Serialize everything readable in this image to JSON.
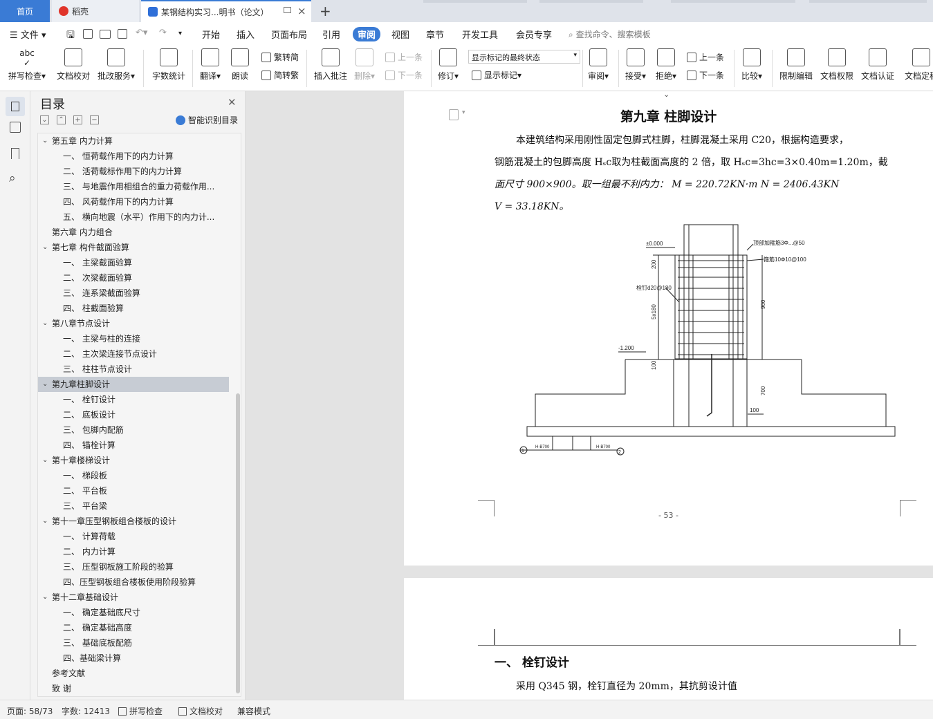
{
  "tabs": {
    "home": "首页",
    "daoke": "稻壳",
    "document": "某钢结构实习...明书（论文）"
  },
  "menu": {
    "file": "文件",
    "items": [
      "开始",
      "插入",
      "页面布局",
      "引用",
      "审阅",
      "视图",
      "章节",
      "开发工具",
      "会员专享"
    ],
    "active": "审阅",
    "search_placeholder": "查找命令、搜索模板"
  },
  "toolbar": {
    "spell_check": "拼写检查",
    "doc_proof": "文档校对",
    "correction_service": "批改服务",
    "word_count": "字数统计",
    "translate": "翻译",
    "read_aloud": "朗读",
    "trad_to_simp": "繁转简",
    "simp_to_trad": "简转繁",
    "insert_comment": "插入批注",
    "delete": "删除",
    "prev_comment": "上一条",
    "next_comment": "下一条",
    "track_changes": "修订",
    "markup_state": "显示标记的最终状态",
    "show_markup": "显示标记",
    "review": "审阅",
    "accept": "接受",
    "reject": "拒绝",
    "prev_change": "上一条",
    "next_change": "下一条",
    "compare": "比较",
    "restrict_edit": "限制编辑",
    "doc_permission": "文档权限",
    "doc_cert": "文档认证",
    "doc_final": "文档定稿"
  },
  "toc": {
    "title": "目录",
    "smart_button": "智能识别目录",
    "items": [
      {
        "text": "第五章  内力计算",
        "level": 1,
        "arrow": true
      },
      {
        "text": "一、    恒荷载作用下的内力计算",
        "level": 2
      },
      {
        "text": "二、    活荷载标作用下的内力计算",
        "level": 2
      },
      {
        "text": "三、    与地震作用相组合的重力荷载作用...",
        "level": 2
      },
      {
        "text": "四、    风荷载作用下的内力计算",
        "level": 2
      },
      {
        "text": "五、    横向地震（水平）作用下的内力计...",
        "level": 2
      },
      {
        "text": "第六章  内力组合",
        "level": 1,
        "arrow": false
      },
      {
        "text": "第七章  构件截面验算",
        "level": 1,
        "arrow": true
      },
      {
        "text": "一、    主梁截面验算",
        "level": 2
      },
      {
        "text": "二、    次梁截面验算",
        "level": 2
      },
      {
        "text": "三、    连系梁截面验算",
        "level": 2
      },
      {
        "text": "四、    柱截面验算",
        "level": 2
      },
      {
        "text": "第八章节点设计",
        "level": 1,
        "arrow": true
      },
      {
        "text": "一、    主梁与柱的连接",
        "level": 2
      },
      {
        "text": "二、    主次梁连接节点设计",
        "level": 2
      },
      {
        "text": "三、    柱柱节点设计",
        "level": 2
      },
      {
        "text": "第九章柱脚设计",
        "level": 1,
        "arrow": true,
        "selected": true
      },
      {
        "text": "一、    栓钉设计",
        "level": 2
      },
      {
        "text": "二、    底板设计",
        "level": 2
      },
      {
        "text": "三、    包脚内配筋",
        "level": 2
      },
      {
        "text": "四、    锚栓计算",
        "level": 2
      },
      {
        "text": "第十章楼梯设计",
        "level": 1,
        "arrow": true
      },
      {
        "text": "一、    梯段板",
        "level": 2
      },
      {
        "text": "二、    平台板",
        "level": 2
      },
      {
        "text": "三、    平台梁",
        "level": 2
      },
      {
        "text": "第十一章压型钢板组合楼板的设计",
        "level": 1,
        "arrow": true
      },
      {
        "text": "一、    计算荷载",
        "level": 2
      },
      {
        "text": "二、    内力计算",
        "level": 2
      },
      {
        "text": "三、    压型钢板施工阶段的验算",
        "level": 2
      },
      {
        "text": "四、压型钢板组合楼板使用阶段验算",
        "level": 3
      },
      {
        "text": "第十二章基础设计",
        "level": 1,
        "arrow": true
      },
      {
        "text": "一、    确定基础底尺寸",
        "level": 2
      },
      {
        "text": "二、    确定基础高度",
        "level": 2
      },
      {
        "text": "三、    基础底板配筋",
        "level": 2
      },
      {
        "text": "四、基础梁计算",
        "level": 3
      },
      {
        "text": "参考文献",
        "level": 1,
        "arrow": false
      },
      {
        "text": "致    谢",
        "level": 1,
        "arrow": false
      }
    ]
  },
  "page1": {
    "title": "第九章   柱脚设计",
    "line1": "本建筑结构采用刚性固定包脚式柱脚，柱脚混凝土采用 C20，根据构造要求，",
    "line2": "钢筋混凝土的包脚高度 Hₛc取为柱截面高度的 2 倍，取 Hₛc=3hc=3×0.40m=1.20m，截",
    "line3": "面尺寸 900×900。取一组最不利内力：  M = 220.72KN·m       N = 2406.43KN",
    "line4": "V = 33.18KN。",
    "drawing": {
      "elev_top": "±0.000",
      "elev_bottom": "-1.200",
      "label_top_right": "顶部加箍筋3Φ...@50",
      "label_stirrup": "箍筋10Φ10@100",
      "label_stud": "栓钉d20@180",
      "dim_200": "200",
      "dim_5x180": "5x180",
      "dim_900": "900",
      "dim_100a": "100",
      "dim_700": "700",
      "dim_100b": "100",
      "axis_label_left": "H-B700",
      "axis_label_right": "H-B700",
      "axis_1": "1",
      "axis_2": "2"
    },
    "page_number": "- 53 -"
  },
  "page2": {
    "heading": "一、    栓钉设计",
    "text": "采用 Q345 钢，栓钉直径为 20mm，其抗剪设计值"
  },
  "status": {
    "page": "页面: 58/73",
    "words": "字数: 12413",
    "spell": "拼写检查",
    "proof": "文档校对",
    "mode": "兼容模式"
  }
}
